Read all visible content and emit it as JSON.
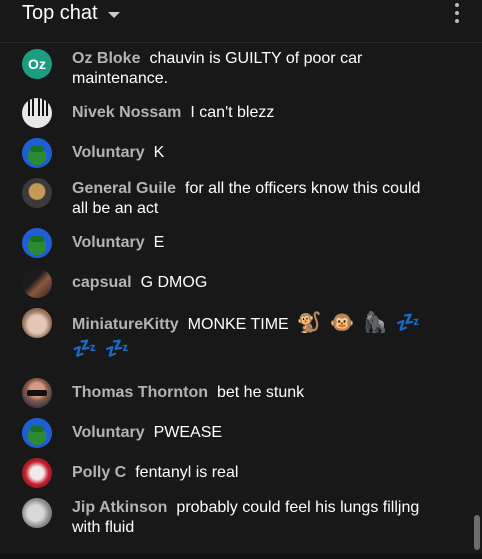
{
  "header": {
    "title": "Top chat"
  },
  "messages": [
    {
      "author": "Oz Bloke",
      "text": "chauvin is GUILTY of poor car maintenance.",
      "avatar_initials": "Oz"
    },
    {
      "author": "Nivek Nossam",
      "text": "I can't blezz"
    },
    {
      "author": "Voluntary",
      "text": "K"
    },
    {
      "author": "General Guile",
      "text": "for all the officers know this could all be an act"
    },
    {
      "author": "Voluntary",
      "text": "E"
    },
    {
      "author": "capsual",
      "text": "G DMOG"
    },
    {
      "author": "MiniatureKitty",
      "text": "MONKE TIME",
      "emojis": [
        "🐒",
        "🐵",
        "🦍",
        "💤",
        "💤",
        "💤"
      ]
    },
    {
      "author": "Thomas Thornton",
      "text": "bet he stunk"
    },
    {
      "author": "Voluntary",
      "text": "PWEASE"
    },
    {
      "author": "Polly C",
      "text": "fentanyl is real"
    },
    {
      "author": "Jip Atkinson",
      "text": "probably could feel his lungs filljng with fluid"
    }
  ],
  "colors": {
    "background": "#181818",
    "author": "#b3b3b3",
    "text": "#ffffff"
  }
}
